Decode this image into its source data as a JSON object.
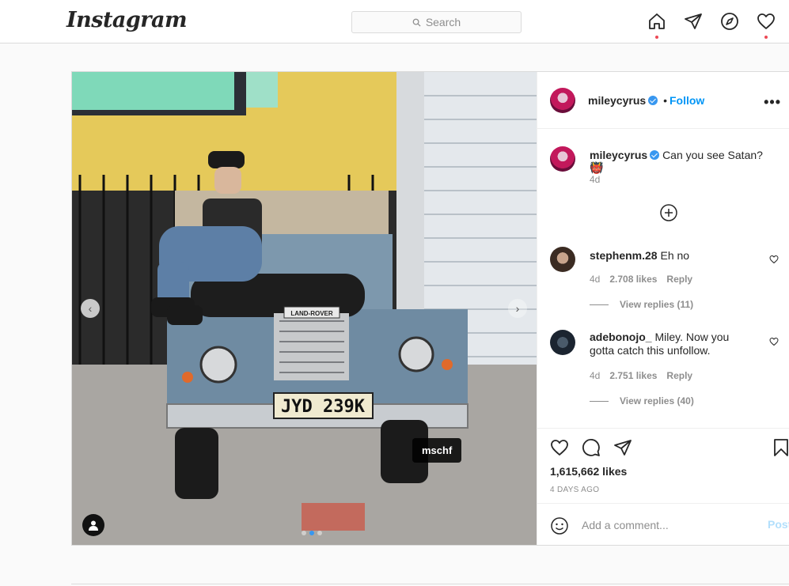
{
  "app": {
    "logo_text": "Instagram"
  },
  "search": {
    "placeholder": "Search"
  },
  "nav": {
    "icons": [
      "home-icon",
      "direct-icon",
      "explore-icon",
      "activity-icon"
    ]
  },
  "photo": {
    "tag_label": "mschf",
    "license_plate": "JYD 239K",
    "badge_text": "LAND-ROVER",
    "carousel_count": 3,
    "carousel_active": 1
  },
  "post": {
    "author": "mileycyrus",
    "follow_label": "Follow",
    "more_label": "•••",
    "caption": "Can you see Satan? 👹",
    "caption_time": "4d",
    "likes": "1,615,662 likes",
    "time_ago": "4 DAYS AGO"
  },
  "comments": [
    {
      "user": "stephenm.28",
      "text": "Eh no",
      "time": "4d",
      "likes": "2.708 likes",
      "reply_label": "Reply",
      "view_replies": "View replies (11)"
    },
    {
      "user": "adebonojo_",
      "text": "Miley. Now you gotta catch this unfollow.",
      "time": "4d",
      "likes": "2.751 likes",
      "reply_label": "Reply",
      "view_replies": "View replies (40)"
    }
  ],
  "comment_box": {
    "placeholder": "Add a comment...",
    "post_label": "Post"
  },
  "colors": {
    "accent": "#0095f6",
    "notification": "#ed4956",
    "border": "#dbdbdb"
  }
}
